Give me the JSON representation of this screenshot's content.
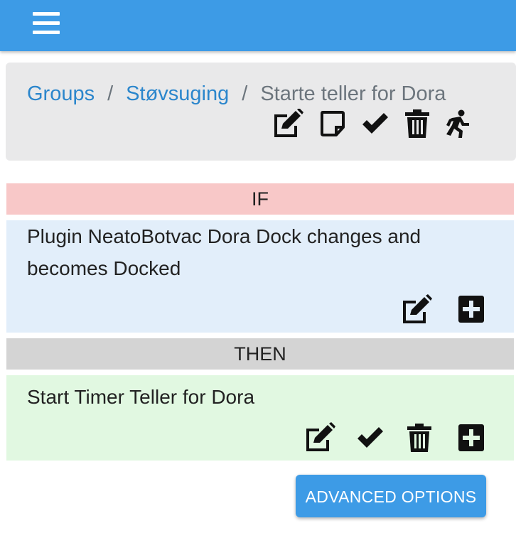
{
  "app": {
    "header_color": "#3d9be6",
    "menu_icon": "hamburger-menu-icon"
  },
  "breadcrumb": {
    "items": [
      {
        "label": "Groups"
      },
      {
        "label": "Støvsuging"
      }
    ],
    "current": "Starte teller for Dora",
    "separator": "/",
    "actions": [
      "edit-icon",
      "note-icon",
      "check-icon",
      "trash-icon",
      "run-icon"
    ]
  },
  "rule": {
    "if_label": "IF",
    "if_text": "Plugin NeatoBotvac Dora Dock changes and becomes Docked",
    "if_actions": [
      "edit-icon",
      "add-icon"
    ],
    "then_label": "THEN",
    "then_text": "Start Timer Teller for Dora",
    "then_actions": [
      "edit-icon",
      "check-icon",
      "trash-icon",
      "add-icon"
    ]
  },
  "buttons": {
    "advanced_options": "ADVANCED OPTIONS"
  }
}
